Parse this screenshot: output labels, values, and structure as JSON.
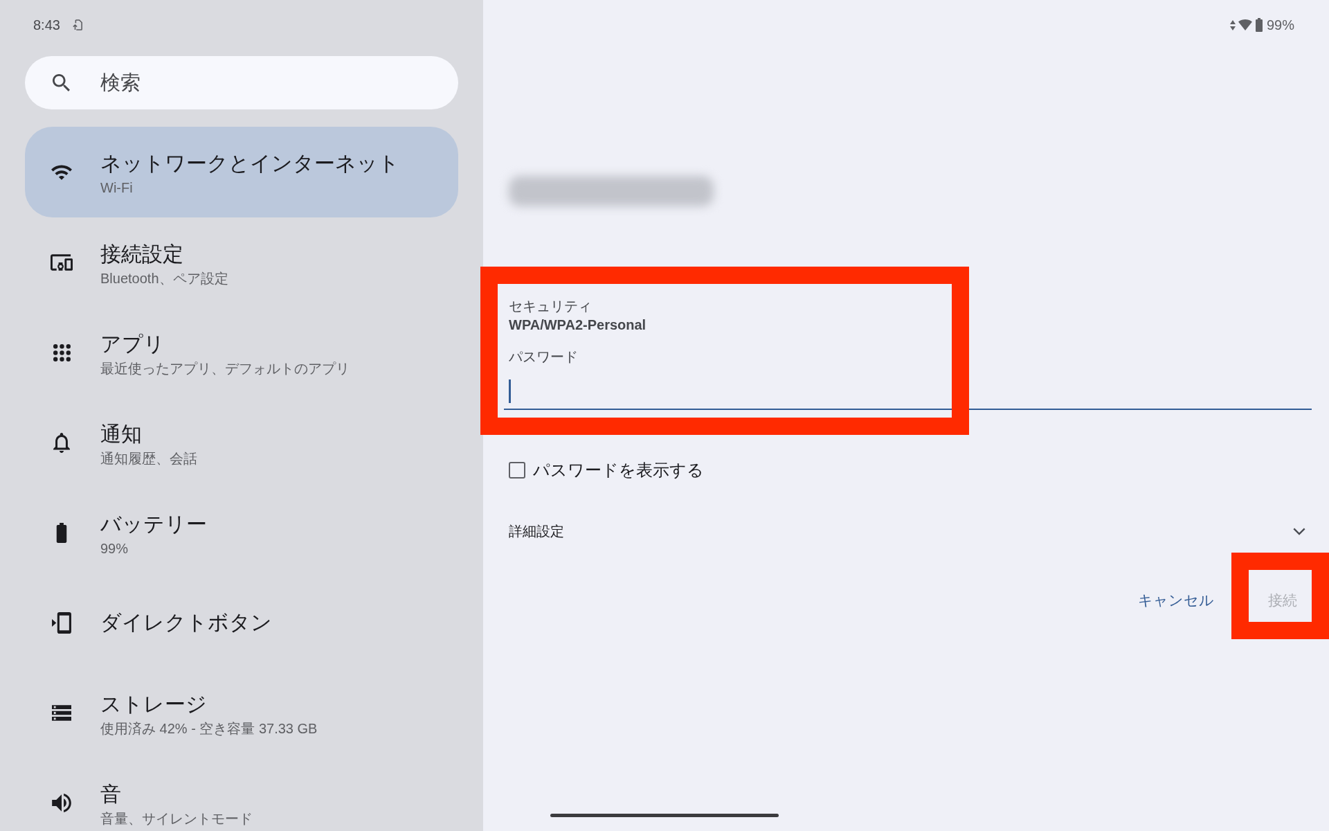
{
  "status_bar": {
    "time": "8:43",
    "battery": "99%"
  },
  "sidebar": {
    "search": {
      "placeholder": "検索"
    },
    "items": [
      {
        "title": "ネットワークとインターネット",
        "subtitle": "Wi-Fi",
        "selected": true
      },
      {
        "title": "接続設定",
        "subtitle": "Bluetooth、ペア設定",
        "selected": false
      },
      {
        "title": "アプリ",
        "subtitle": "最近使ったアプリ、デフォルトのアプリ",
        "selected": false
      },
      {
        "title": "通知",
        "subtitle": "通知履歴、会話",
        "selected": false
      },
      {
        "title": "バッテリー",
        "subtitle": "99%",
        "selected": false
      },
      {
        "title": "ダイレクトボタン",
        "selected": false
      },
      {
        "title": "ストレージ",
        "subtitle": "使用済み 42% - 空き容量 37.33 GB",
        "selected": false
      },
      {
        "title": "音",
        "subtitle": "音量、サイレントモード",
        "selected": false
      }
    ]
  },
  "wifi_dialog": {
    "network_name": {
      "blurred": true
    },
    "credentials": {
      "highlighted": true,
      "security": {
        "label": "セキュリティ",
        "value": "WPA/WPA2-Personal"
      },
      "password": {
        "label": "パスワード",
        "focused": true
      }
    },
    "show_password": {
      "label": "パスワードを表示する",
      "checked": false
    },
    "advanced": {
      "label": "詳細設定",
      "expanded": false
    },
    "buttons": [
      {
        "label": "キャンセル",
        "disabled": false,
        "highlighted": false
      },
      {
        "label": "接続",
        "disabled": true,
        "highlighted": true
      }
    ]
  }
}
